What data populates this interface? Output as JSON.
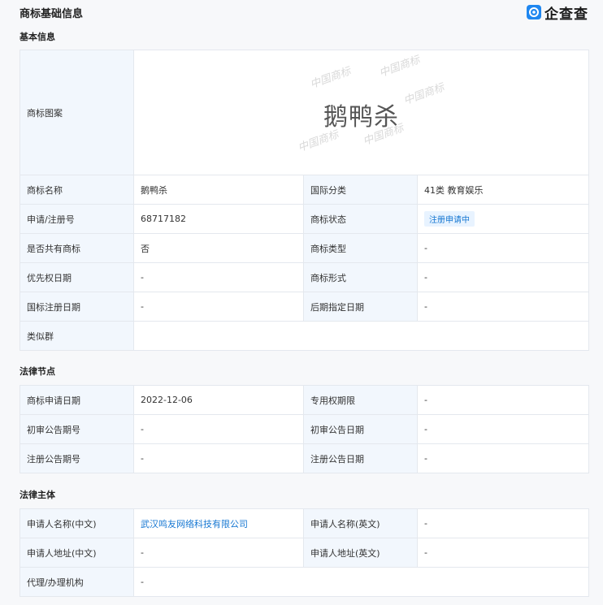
{
  "header": {
    "title": "商标基础信息",
    "brand": "企查查"
  },
  "basic": {
    "section_title": "基本信息",
    "logo_label": "商标图案",
    "mark_text": "鹅鸭杀",
    "watermark": "中国商标",
    "name_label": "商标名称",
    "name_value": "鹅鸭杀",
    "intl_class_label": "国际分类",
    "intl_class_value": "41类 教育娱乐",
    "reg_no_label": "申请/注册号",
    "reg_no_value": "68717182",
    "status_label": "商标状态",
    "status_value": "注册申请中",
    "shared_label": "是否共有商标",
    "shared_value": "否",
    "type_label": "商标类型",
    "type_value": "-",
    "priority_label": "优先权日期",
    "priority_value": "-",
    "form_label": "商标形式",
    "form_value": "-",
    "intl_reg_date_label": "国标注册日期",
    "intl_reg_date_value": "-",
    "later_date_label": "后期指定日期",
    "later_date_value": "-",
    "similar_group_label": "类似群",
    "similar_group_value": ""
  },
  "legal": {
    "section_title": "法律节点",
    "apply_date_label": "商标申请日期",
    "apply_date_value": "2022-12-06",
    "exclusive_label": "专用权期限",
    "exclusive_value": "-",
    "prelim_no_label": "初审公告期号",
    "prelim_no_value": "-",
    "prelim_date_label": "初审公告日期",
    "prelim_date_value": "-",
    "reg_no_label": "注册公告期号",
    "reg_no_value": "-",
    "reg_date_label": "注册公告日期",
    "reg_date_value": "-"
  },
  "subject": {
    "section_title": "法律主体",
    "applicant_cn_label": "申请人名称(中文)",
    "applicant_cn_value": "武汉鸣友网络科技有限公司",
    "applicant_en_label": "申请人名称(英文)",
    "applicant_en_value": "-",
    "address_cn_label": "申请人地址(中文)",
    "address_cn_value": "-",
    "address_en_label": "申请人地址(英文)",
    "address_en_value": "-",
    "agent_label": "代理/办理机构",
    "agent_value": "-"
  },
  "colors": {
    "label_bg": "#f2f7fd",
    "border": "#e4e8ee",
    "link": "#1677d2",
    "brand_blue": "#1f87f0"
  }
}
